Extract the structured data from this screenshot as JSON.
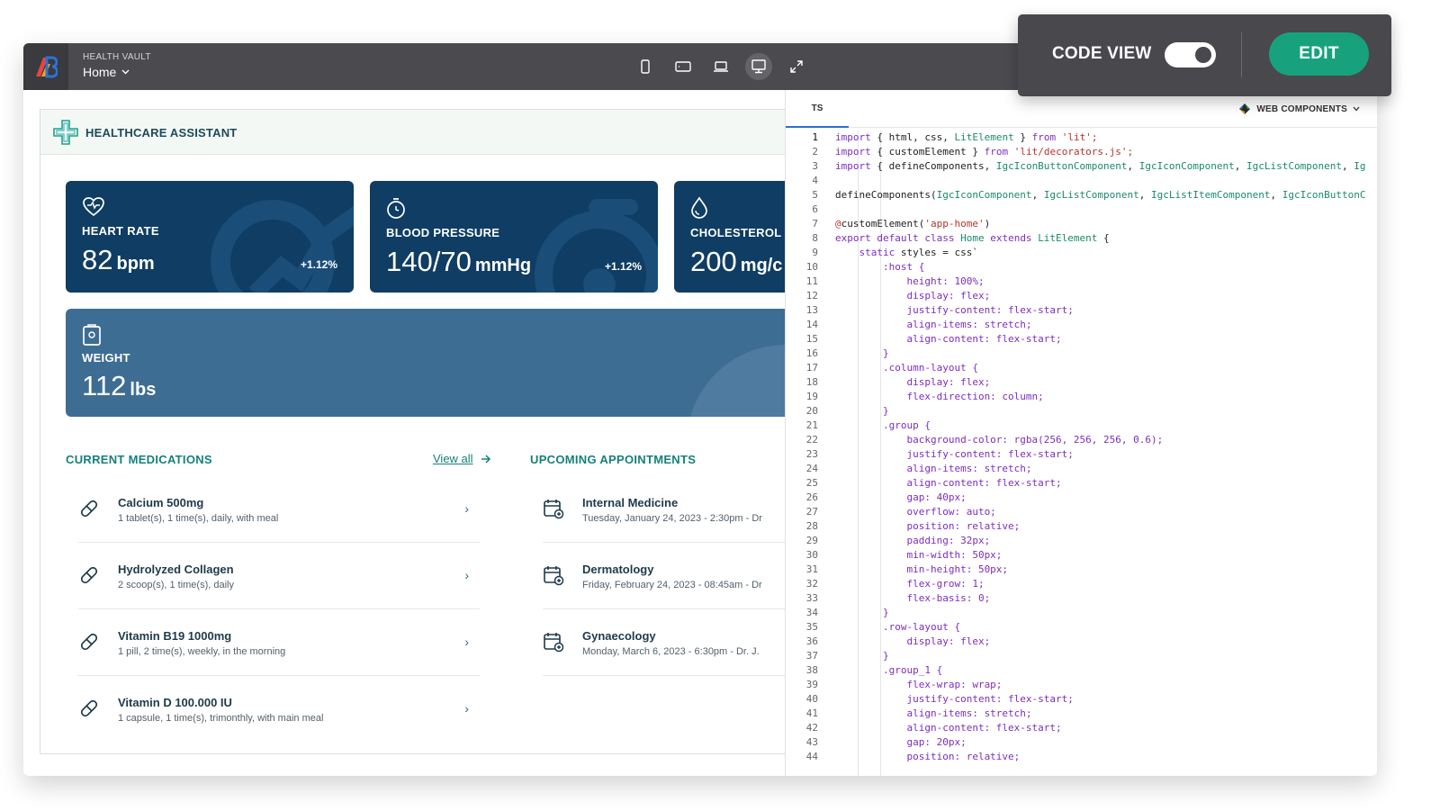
{
  "app": {
    "name": "HEALTH VAULT",
    "page": "Home"
  },
  "devices": [
    "phone-icon",
    "tablet-icon",
    "laptop-icon",
    "desktop-icon",
    "fullscreen-icon"
  ],
  "assistant": {
    "title": "HEALTHCARE ASSISTANT"
  },
  "cards": {
    "heart": {
      "label": "HEART RATE",
      "value": "82",
      "unit": "bpm",
      "change": "+1.12%"
    },
    "bp": {
      "label": "BLOOD PRESSURE",
      "value": "140/70",
      "unit": "mmHg",
      "change": "+1.12%"
    },
    "chol": {
      "label": "CHOLESTEROL",
      "value": "200",
      "unit": "mg/c"
    },
    "weight": {
      "label": "WEIGHT",
      "value": "112",
      "unit": "lbs"
    }
  },
  "medications": {
    "title": "CURRENT MEDICATIONS",
    "view_all": "View all",
    "items": [
      {
        "name": "Calcium 500mg",
        "detail": "1 tablet(s), 1 time(s), daily, with meal"
      },
      {
        "name": "Hydrolyzed Collagen",
        "detail": "2 scoop(s), 1 time(s), daily"
      },
      {
        "name": "Vitamin B19 1000mg",
        "detail": "1 pill, 2 time(s), weekly, in the morning"
      },
      {
        "name": "Vitamin D 100.000 IU",
        "detail": "1 capsule, 1 time(s), trimonthly, with main meal"
      }
    ]
  },
  "appointments": {
    "title": "UPCOMING APPOINTMENTS",
    "items": [
      {
        "name": "Internal Medicine",
        "detail": "Tuesday, January 24, 2023 - 2:30pm - Dr"
      },
      {
        "name": "Dermatology",
        "detail": "Friday, February 24, 2023 - 08:45am - Dr"
      },
      {
        "name": "Gynaecology",
        "detail": "Monday, March 6, 2023 - 6:30pm - Dr. J."
      }
    ]
  },
  "code_panel": {
    "tab": "TS",
    "framework": "WEB COMPONENTS",
    "lines": [
      [
        {
          "t": "import",
          "c": "#7d2dbd"
        },
        {
          "t": " { html, css, "
        },
        {
          "t": "LitElement",
          "c": "#1a8a6b"
        },
        {
          "t": " } "
        },
        {
          "t": "from",
          "c": "#7d2dbd"
        },
        {
          "t": " 'lit';",
          "c": "#b5342a"
        }
      ],
      [
        {
          "t": "import",
          "c": "#7d2dbd"
        },
        {
          "t": " { customElement } "
        },
        {
          "t": "from",
          "c": "#7d2dbd"
        },
        {
          "t": " 'lit/decorators.js';",
          "c": "#b5342a"
        }
      ],
      [
        {
          "t": "import",
          "c": "#7d2dbd"
        },
        {
          "t": " { defineComponents, "
        },
        {
          "t": "IgcIconButtonComponent",
          "c": "#1a8a6b"
        },
        {
          "t": ", "
        },
        {
          "t": "IgcIconComponent",
          "c": "#1a8a6b"
        },
        {
          "t": ", "
        },
        {
          "t": "IgcListComponent",
          "c": "#1a8a6b"
        },
        {
          "t": ", "
        },
        {
          "t": "Ig",
          "c": "#1a8a6b"
        }
      ],
      [],
      [
        {
          "t": "defineComponents("
        },
        {
          "t": "IgcIconComponent",
          "c": "#1a8a6b"
        },
        {
          "t": ", "
        },
        {
          "t": "IgcListComponent",
          "c": "#1a8a6b"
        },
        {
          "t": ", "
        },
        {
          "t": "IgcListItemComponent",
          "c": "#1a8a6b"
        },
        {
          "t": ", "
        },
        {
          "t": "IgcIconButtonC",
          "c": "#1a8a6b"
        }
      ],
      [],
      [
        {
          "t": "@",
          "c": "#b5342a"
        },
        {
          "t": "customElement("
        },
        {
          "t": "'app-home'",
          "c": "#b5342a"
        },
        {
          "t": ")"
        }
      ],
      [
        {
          "t": "export default class ",
          "c": "#7d2dbd"
        },
        {
          "t": "Home",
          "c": "#1a8a6b"
        },
        {
          "t": " extends ",
          "c": "#7d2dbd"
        },
        {
          "t": "LitElement",
          "c": "#1a8a6b"
        },
        {
          "t": " {"
        }
      ],
      [
        {
          "t": "    "
        },
        {
          "t": "static",
          "c": "#7d2dbd"
        },
        {
          "t": " styles = css`"
        }
      ],
      [
        {
          "t": "        :host {",
          "c": "#7d2dbd"
        }
      ],
      [
        {
          "t": "            height: 100%;",
          "c": "#7d2dbd"
        }
      ],
      [
        {
          "t": "            display: flex;",
          "c": "#7d2dbd"
        }
      ],
      [
        {
          "t": "            justify-content: flex-start;",
          "c": "#7d2dbd"
        }
      ],
      [
        {
          "t": "            align-items: stretch;",
          "c": "#7d2dbd"
        }
      ],
      [
        {
          "t": "            align-content: flex-start;",
          "c": "#7d2dbd"
        }
      ],
      [
        {
          "t": "        }",
          "c": "#7d2dbd"
        }
      ],
      [
        {
          "t": "        .column-layout {",
          "c": "#7d2dbd"
        }
      ],
      [
        {
          "t": "            display: flex;",
          "c": "#7d2dbd"
        }
      ],
      [
        {
          "t": "            flex-direction: column;",
          "c": "#7d2dbd"
        }
      ],
      [
        {
          "t": "        }",
          "c": "#7d2dbd"
        }
      ],
      [
        {
          "t": "        .group {",
          "c": "#7d2dbd"
        }
      ],
      [
        {
          "t": "            background-color: rgba(256, 256, 256, 0.6);",
          "c": "#7d2dbd"
        }
      ],
      [
        {
          "t": "            justify-content: flex-start;",
          "c": "#7d2dbd"
        }
      ],
      [
        {
          "t": "            align-items: stretch;",
          "c": "#7d2dbd"
        }
      ],
      [
        {
          "t": "            align-content: flex-start;",
          "c": "#7d2dbd"
        }
      ],
      [
        {
          "t": "            gap: 40px;",
          "c": "#7d2dbd"
        }
      ],
      [
        {
          "t": "            overflow: auto;",
          "c": "#7d2dbd"
        }
      ],
      [
        {
          "t": "            position: relative;",
          "c": "#7d2dbd"
        }
      ],
      [
        {
          "t": "            padding: 32px;",
          "c": "#7d2dbd"
        }
      ],
      [
        {
          "t": "            min-width: 50px;",
          "c": "#7d2dbd"
        }
      ],
      [
        {
          "t": "            min-height: 50px;",
          "c": "#7d2dbd"
        }
      ],
      [
        {
          "t": "            flex-grow: 1;",
          "c": "#7d2dbd"
        }
      ],
      [
        {
          "t": "            flex-basis: 0;",
          "c": "#7d2dbd"
        }
      ],
      [
        {
          "t": "        }",
          "c": "#7d2dbd"
        }
      ],
      [
        {
          "t": "        .row-layout {",
          "c": "#7d2dbd"
        }
      ],
      [
        {
          "t": "            display: flex;",
          "c": "#7d2dbd"
        }
      ],
      [
        {
          "t": "        }",
          "c": "#7d2dbd"
        }
      ],
      [
        {
          "t": "        .group_1 {",
          "c": "#7d2dbd"
        }
      ],
      [
        {
          "t": "            flex-wrap: wrap;",
          "c": "#7d2dbd"
        }
      ],
      [
        {
          "t": "            justify-content: flex-start;",
          "c": "#7d2dbd"
        }
      ],
      [
        {
          "t": "            align-items: stretch;",
          "c": "#7d2dbd"
        }
      ],
      [
        {
          "t": "            align-content: flex-start;",
          "c": "#7d2dbd"
        }
      ],
      [
        {
          "t": "            gap: 20px;",
          "c": "#7d2dbd"
        }
      ],
      [
        {
          "t": "            position: relative;",
          "c": "#7d2dbd"
        }
      ]
    ]
  },
  "code_view": {
    "label": "CODE VIEW",
    "enabled": true,
    "edit_label": "EDIT"
  },
  "colors": {
    "card_dark": "#0f3d63",
    "card_weight": "#3e6d94",
    "accent": "#15807a",
    "edit": "#17a27d"
  }
}
